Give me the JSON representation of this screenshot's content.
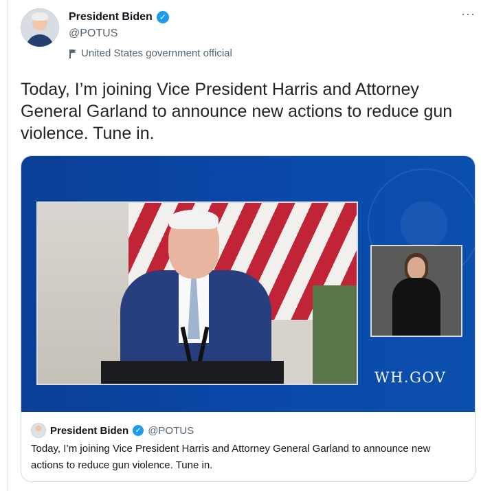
{
  "tweet": {
    "author": {
      "display_name": "President Biden",
      "handle": "@POTUS",
      "label": "United States government official",
      "verified_icon": "verified-check-icon"
    },
    "more_icon": "more-horizontal-icon",
    "text": "Today, I’m joining Vice President Harris and Attorney General Garland to announce new actions to reduce gun violence. Tune in."
  },
  "media": {
    "watermark": "WH.GOV"
  },
  "quote": {
    "display_name": "President Biden",
    "handle": "@POTUS",
    "text": "Today, I’m joining Vice President Harris and Attorney General Garland to announce new actions to reduce gun violence. Tune in."
  },
  "colors": {
    "verified": "#1d9bf0",
    "media_blue": "#0b4fae",
    "muted": "#536471"
  }
}
